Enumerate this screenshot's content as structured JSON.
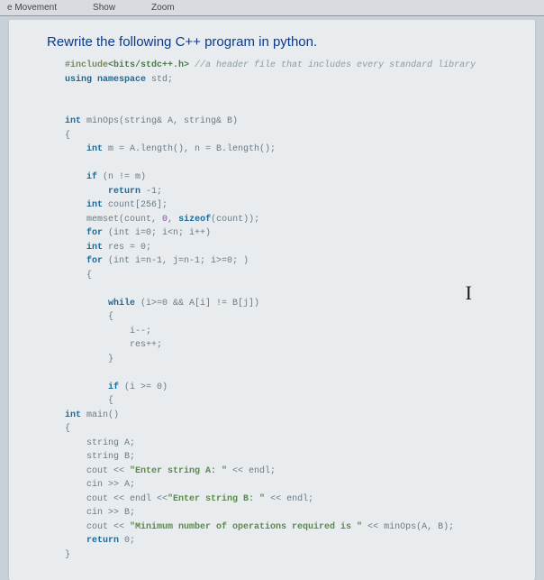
{
  "topbar": {
    "left": "e Movement",
    "mid": "Show",
    "right": "Zoom"
  },
  "heading": "Rewrite the following C++ program in python.",
  "code": {
    "l01_inc": "#include",
    "l01_hdr": "<bits/stdc++.h>",
    "l01_cmt": " //a header file that includes every standard library",
    "l02_a": "using namespace",
    "l02_b": " std;",
    "blank1": "",
    "blank2": "",
    "l03_a": "int",
    "l03_b": " minOps(string& A, string& B)",
    "l04": "{",
    "l05_a": "    int",
    "l05_b": " m = A.length(), n = B.length();",
    "blank3": "",
    "l06_a": "    if",
    "l06_b": " (n != m)",
    "l07_a": "        return",
    "l07_b": " -1;",
    "l08_a": "    int",
    "l08_b": " count[256];",
    "l09_a": "    memset(count, ",
    "l09_b": "0",
    "l09_c": ", ",
    "l09_d": "sizeof",
    "l09_e": "(count));",
    "l10_a": "    for",
    "l10_b": " (int i=0; i<n; i++)",
    "l11_a": "    int",
    "l11_b": " res = 0;",
    "l12_a": "    for",
    "l12_b": " (int i=n-1, j=n-1; i>=0; )",
    "l13": "    {",
    "blank4": "",
    "l14_a": "        while",
    "l14_b": " (i>=0 && A[i] != B[j])",
    "l15": "        {",
    "l16": "            i--;",
    "l17": "            res++;",
    "l18": "        }",
    "blank5": "",
    "l19_a": "        if",
    "l19_b": " (i >= 0)",
    "l20": "        {",
    "l21_a": "int",
    "l21_b": " main()",
    "l22": "{",
    "l23": "    string A;",
    "l24": "    string B;",
    "l25_a": "    cout << ",
    "l25_b": "\"Enter string A: \"",
    "l25_c": " << endl;",
    "l26": "    cin >> A;",
    "l27_a": "    cout << endl <<",
    "l27_b": "\"Enter string B: \"",
    "l27_c": " << endl;",
    "l28": "    cin >> B;",
    "l29_a": "    cout << ",
    "l29_b": "\"Minimum number of operations required is \"",
    "l29_c": " << minOps(A, B);",
    "l30_a": "    return",
    "l30_b": " 0;",
    "l31": "}"
  },
  "caret": "I"
}
